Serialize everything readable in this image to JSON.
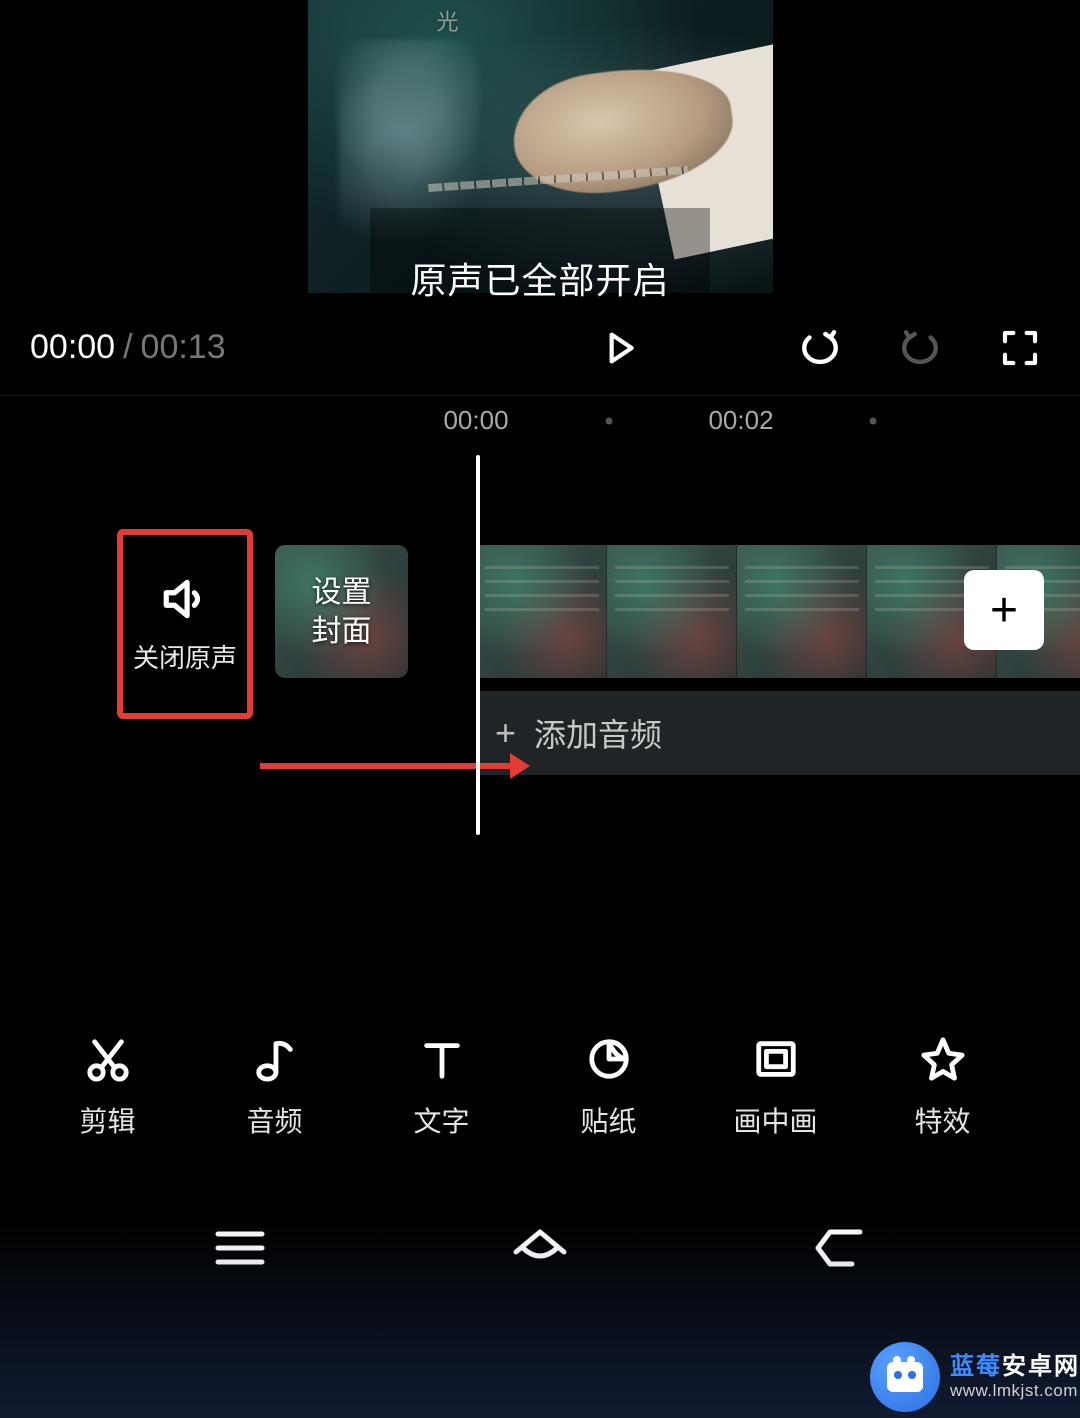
{
  "preview": {
    "poster_text": "光",
    "toast": "原声已全部开启"
  },
  "playback": {
    "current": "00:00",
    "separator": "/",
    "total": "00:13"
  },
  "timeline": {
    "ticks": [
      "00:00",
      "00:02"
    ],
    "mute_label": "关闭原声",
    "cover_label": "设置\n封面",
    "add_clip_glyph": "+",
    "audio_add_glyph": "+",
    "audio_add_label": "添加音频"
  },
  "tools": [
    {
      "key": "edit",
      "label": "剪辑"
    },
    {
      "key": "audio",
      "label": "音频"
    },
    {
      "key": "text",
      "label": "文字"
    },
    {
      "key": "sticker",
      "label": "贴纸"
    },
    {
      "key": "pip",
      "label": "画中画"
    },
    {
      "key": "fx",
      "label": "特效"
    }
  ],
  "watermark": {
    "brand_prefix": "蓝莓",
    "brand_suffix": "安卓网",
    "url": "www.lmkjst.com"
  }
}
